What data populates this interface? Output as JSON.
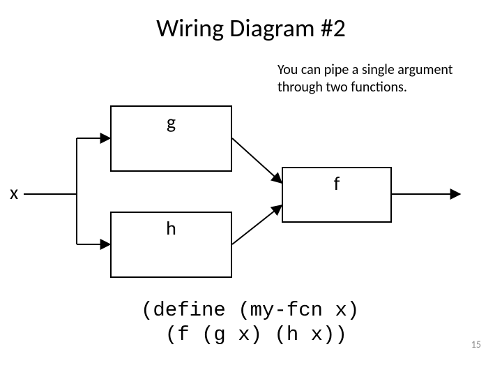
{
  "title": "Wiring Diagram #2",
  "subtitle": "You can pipe a single argument through two functions.",
  "labels": {
    "x": "x",
    "g": "g",
    "h": "h",
    "f": "f"
  },
  "code": "(define (my-fcn x)\n  (f (g x) (h x))",
  "page_number": "15"
}
